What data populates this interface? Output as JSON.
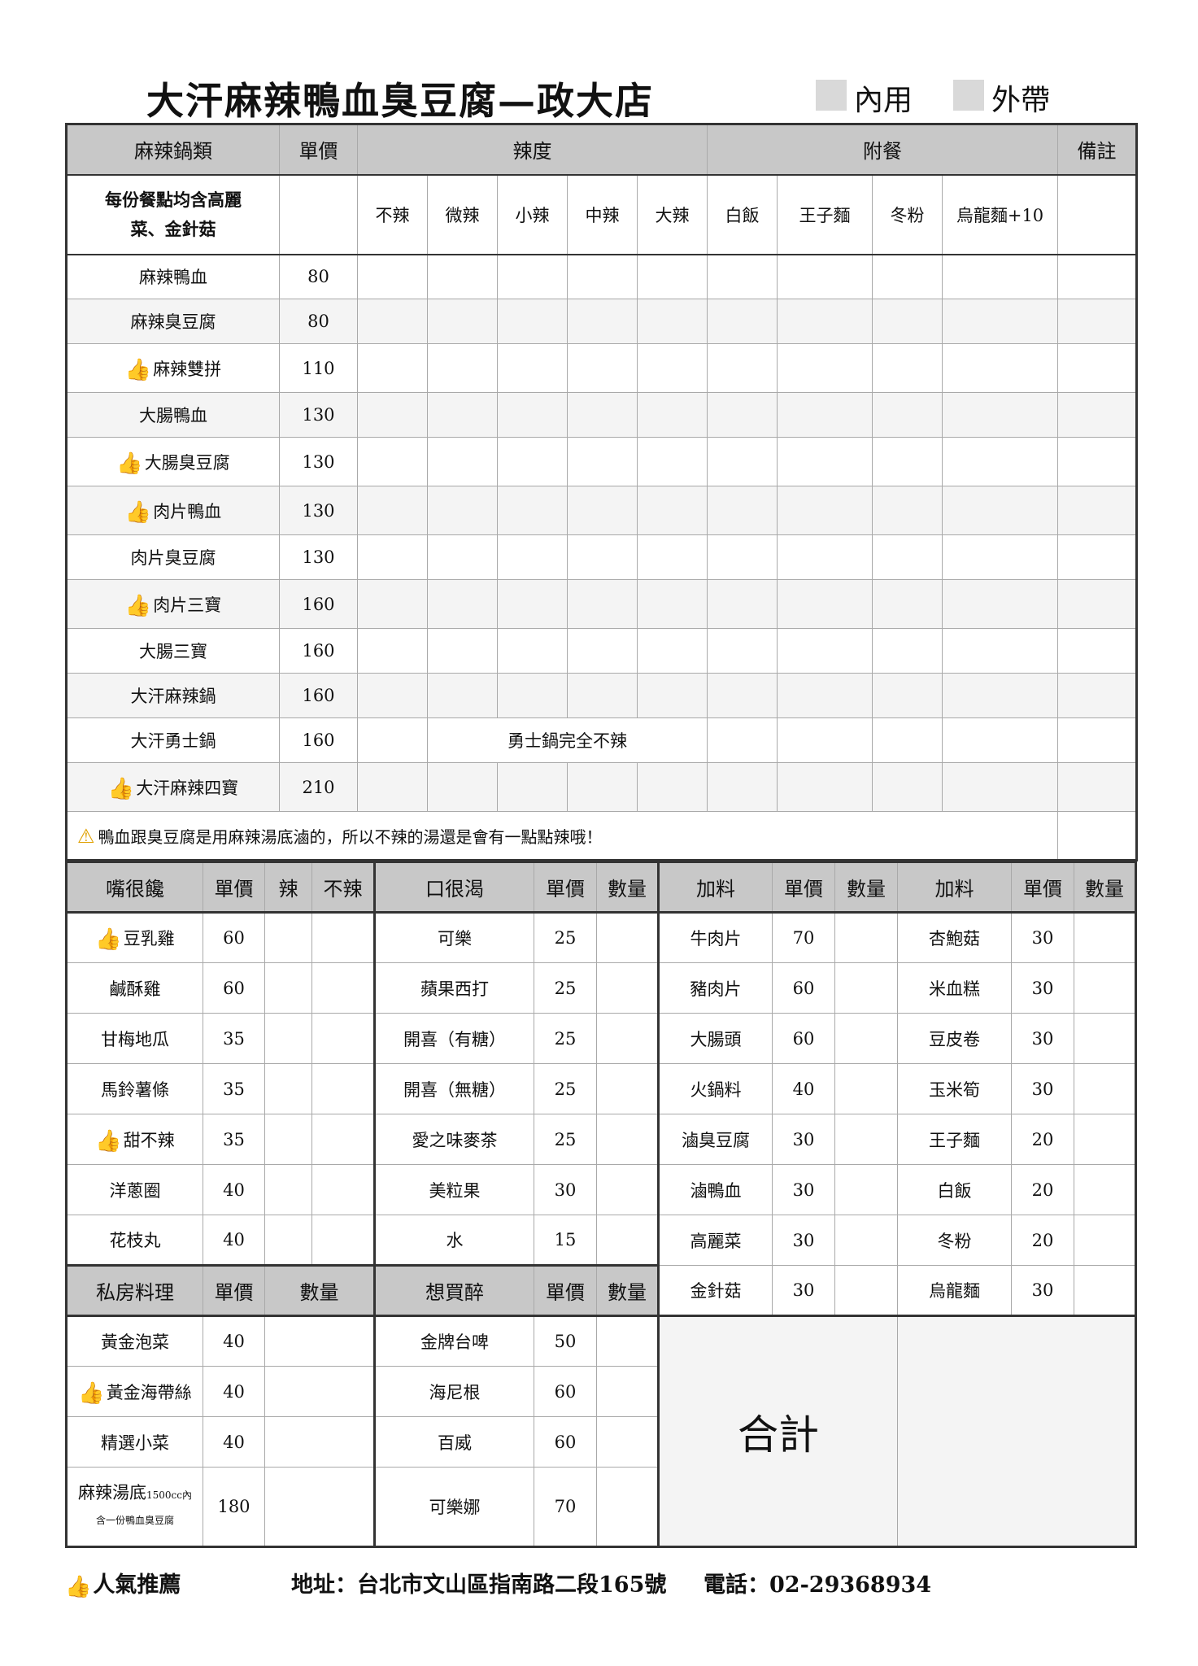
{
  "header": {
    "title": "大汗麻辣鴨血臭豆腐—政大店",
    "dine_in_label": "內用",
    "takeout_label": "外帶"
  },
  "main": {
    "col_headers": {
      "category": "麻辣鍋類",
      "price": "單價",
      "spice": "辣度",
      "side": "附餐",
      "note": "備註"
    },
    "subheader_note": "每份餐點均含高麗菜、金針菇",
    "spice_levels": [
      "不辣",
      "微辣",
      "小辣",
      "中辣",
      "大辣"
    ],
    "sides": [
      "白飯",
      "王子麵",
      "冬粉",
      "烏龍麵+10"
    ],
    "items": [
      {
        "name": "麻辣鴨血",
        "price": "80"
      },
      {
        "name": "麻辣臭豆腐",
        "price": "80"
      },
      {
        "name": "麻辣雙拼",
        "price": "110"
      },
      {
        "name": "大腸鴨血",
        "price": "130"
      },
      {
        "name": "大腸臭豆腐",
        "price": "130"
      },
      {
        "name": "肉片鴨血",
        "price": "130"
      },
      {
        "name": "肉片臭豆腐",
        "price": "130"
      },
      {
        "name": "肉片三寶",
        "price": "160"
      },
      {
        "name": "大腸三寶",
        "price": "160"
      },
      {
        "name": "大汗麻辣鍋",
        "price": "160"
      },
      {
        "name": "大汗勇士鍋",
        "price": "160"
      },
      {
        "name": "大汗麻辣四寶",
        "price": "210"
      }
    ],
    "warrior_note": "勇士鍋完全不辣",
    "warning": "鴨血跟臭豆腐是用麻辣湯底滷的，所以不辣的湯還是會有一點點辣哦！"
  },
  "snacks": {
    "header": "嘴很饞",
    "price_label": "單價",
    "spicy_label": "辣",
    "not_spicy_label": "不辣",
    "items": [
      {
        "name": "豆乳雞",
        "price": "60"
      },
      {
        "name": "鹹酥雞",
        "price": "60"
      },
      {
        "name": "甘梅地瓜",
        "price": "35"
      },
      {
        "name": "馬鈴薯條",
        "price": "35"
      },
      {
        "name": "甜不辣",
        "price": "35"
      },
      {
        "name": "洋蔥圈",
        "price": "40"
      },
      {
        "name": "花枝丸",
        "price": "40"
      }
    ]
  },
  "drinks": {
    "header": "口很渴",
    "price_label": "單價",
    "qty_label": "數量",
    "items": [
      {
        "name": "可樂",
        "price": "25"
      },
      {
        "name": "蘋果西打",
        "price": "25"
      },
      {
        "name": "開喜（有糖）",
        "price": "25"
      },
      {
        "name": "開喜（無糖）",
        "price": "25"
      },
      {
        "name": "愛之味麥茶",
        "price": "25"
      },
      {
        "name": "美粒果",
        "price": "30"
      },
      {
        "name": "水",
        "price": "15"
      }
    ]
  },
  "addons1": {
    "header": "加料",
    "price_label": "單價",
    "qty_label": "數量",
    "items": [
      {
        "name": "牛肉片",
        "price": "70"
      },
      {
        "name": "豬肉片",
        "price": "60"
      },
      {
        "name": "大腸頭",
        "price": "60"
      },
      {
        "name": "火鍋料",
        "price": "40"
      },
      {
        "name": "滷臭豆腐",
        "price": "30"
      },
      {
        "name": "滷鴨血",
        "price": "30"
      },
      {
        "name": "高麗菜",
        "price": "30"
      },
      {
        "name": "金針菇",
        "price": "30"
      }
    ]
  },
  "addons2": {
    "header": "加料",
    "price_label": "單價",
    "qty_label": "數量",
    "items": [
      {
        "name": "杏鮑菇",
        "price": "30"
      },
      {
        "name": "米血糕",
        "price": "30"
      },
      {
        "name": "豆皮卷",
        "price": "30"
      },
      {
        "name": "玉米筍",
        "price": "30"
      },
      {
        "name": "王子麵",
        "price": "20"
      },
      {
        "name": "白飯",
        "price": "20"
      },
      {
        "name": "冬粉",
        "price": "20"
      },
      {
        "name": "烏龍麵",
        "price": "30"
      }
    ]
  },
  "private": {
    "header": "私房料理",
    "price_label": "單價",
    "qty_label": "數量",
    "items": [
      {
        "name": "黃金泡菜",
        "price": "40"
      },
      {
        "name": "黃金海帶絲",
        "price": "40"
      },
      {
        "name": "精選小菜",
        "price": "40"
      },
      {
        "name": "麻辣湯底",
        "price": "180",
        "note1": "1500cc內",
        "note2": "含一份鴨血臭豆腐"
      }
    ]
  },
  "beer": {
    "header": "想買醉",
    "price_label": "單價",
    "qty_label": "數量",
    "items": [
      {
        "name": "金牌台啤",
        "price": "50"
      },
      {
        "name": "海尼根",
        "price": "60"
      },
      {
        "name": "百威",
        "price": "60"
      },
      {
        "name": "可樂娜",
        "price": "70"
      }
    ]
  },
  "total_label": "合計",
  "footer": {
    "popular": "人氣推薦",
    "address": "地址：台北市文山區指南路二段165號",
    "phone": "電話：02-29368934"
  }
}
